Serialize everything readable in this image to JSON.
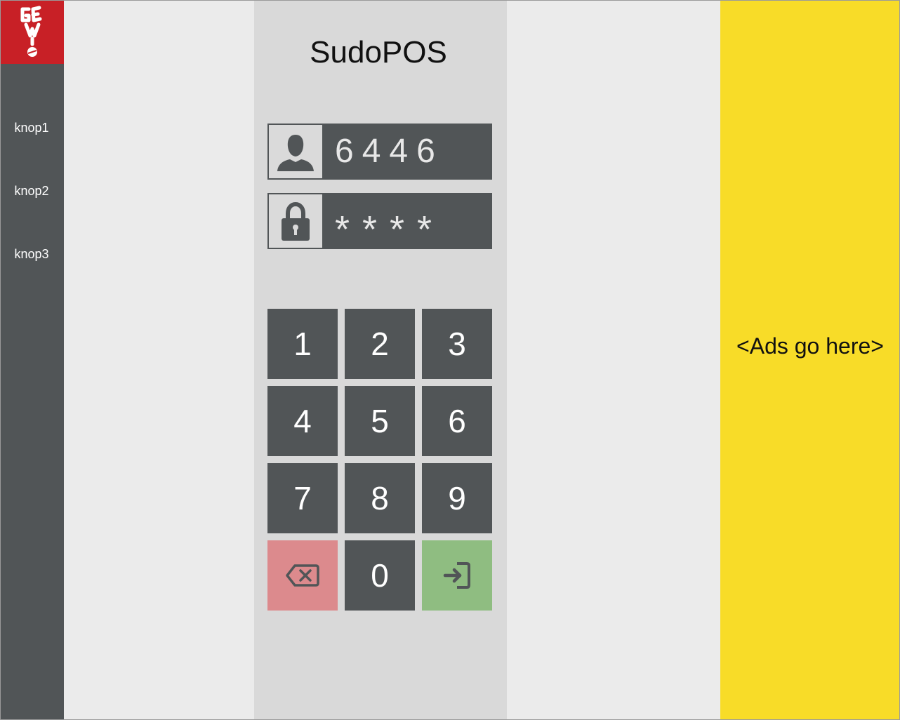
{
  "sidebar": {
    "logo_text": "GEWIS",
    "items": [
      {
        "label": "knop1"
      },
      {
        "label": "knop2"
      },
      {
        "label": "knop3"
      }
    ]
  },
  "login": {
    "title": "SudoPOS",
    "user_icon": "user-icon",
    "user_value": "6446",
    "lock_icon": "lock-icon",
    "password_value": "****"
  },
  "keypad": {
    "keys": [
      "1",
      "2",
      "3",
      "4",
      "5",
      "6",
      "7",
      "8",
      "9",
      "0"
    ],
    "delete_icon": "backspace-icon",
    "enter_icon": "login-icon"
  },
  "ads": {
    "text": "<Ads go here>"
  },
  "colors": {
    "sidebar": "#515557",
    "logo_red": "#c82026",
    "panel": "#d9d9d9",
    "key": "#515557",
    "delete": "#dc8a8d",
    "enter": "#8fbd81",
    "ads": "#f8dc28"
  }
}
